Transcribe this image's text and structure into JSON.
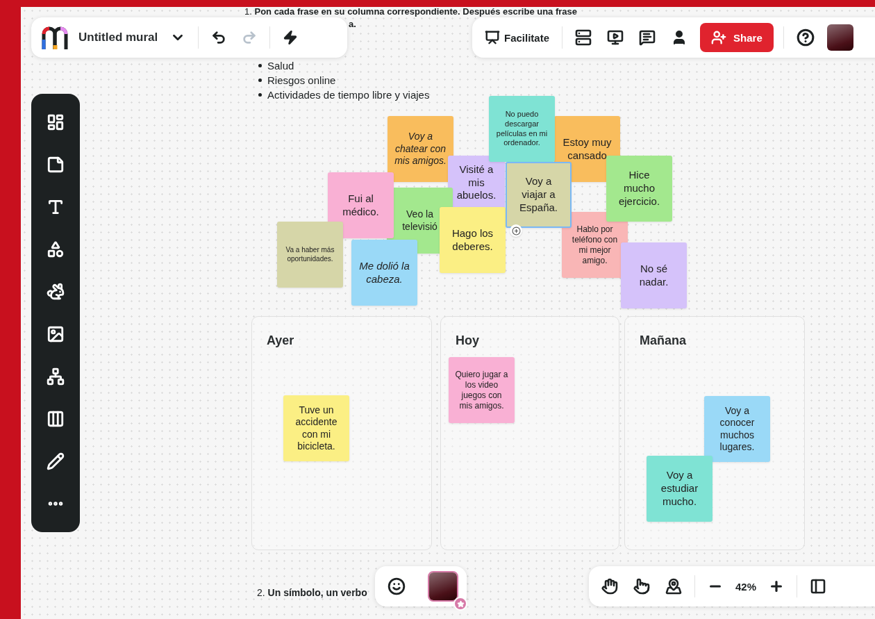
{
  "toolbar": {
    "title": "Untitled mural"
  },
  "topbar": {
    "facilitate": "Facilitate",
    "share": "Share"
  },
  "instructions": {
    "line_1": "1. **Pon cada frase en su columna correspondiente. Después escribe una frase**",
    "line_2_tail": "a."
  },
  "topics": [
    "Salud",
    "Riesgos online",
    "Actividades de tiempo libre y viajes"
  ],
  "stickies": [
    {
      "text": "Voy a chatear con mis amigos.",
      "color": "#f9bd5d",
      "italic": true,
      "selected": false
    },
    {
      "text": "Estoy muy cansado",
      "color": "#f9bd5d",
      "italic": false,
      "selected": false
    },
    {
      "text": "Visité a mis abuelos.",
      "color": "#d5c2fa",
      "italic": false,
      "selected": false
    },
    {
      "text": "No puedo descargar películas en mi ordenador.",
      "color": "#7fe3d4",
      "italic": false,
      "selected": false
    },
    {
      "text": "Me dolió la cabeza.",
      "color": "#9ad9f7",
      "italic": true,
      "selected": false
    },
    {
      "text": "Veo la televisió",
      "color": "#a3e88e",
      "italic": false,
      "selected": false
    },
    {
      "text": "Fui al médico.",
      "color": "#f9b0d4",
      "italic": false,
      "selected": false
    },
    {
      "text": "Hago los deberes.",
      "color": "#fbef84",
      "italic": false,
      "selected": false
    },
    {
      "text": "Hablo por teléfono con mi mejor amigo.",
      "color": "#f9b6b6",
      "italic": false,
      "selected": false
    },
    {
      "text": "Voy a viajar a España.",
      "color": "#d6d6a8",
      "italic": false,
      "selected": true
    },
    {
      "text": "Hice mucho ejercicio.",
      "color": "#a3e88e",
      "italic": false,
      "selected": false
    },
    {
      "text": "No sé nadar.",
      "color": "#d5c2fa",
      "italic": false,
      "selected": false
    },
    {
      "text": "Va a haber más oportunidades.",
      "color": "#d6d6a8",
      "italic": false,
      "selected": false
    }
  ],
  "columns": [
    {
      "title": "Ayer",
      "stickies": [
        {
          "text": "Tuve un accidente con mi bicicleta.",
          "color": "#fbef84"
        }
      ]
    },
    {
      "title": "Hoy",
      "stickies": [
        {
          "text": "Quiero jugar a los video juegos con mis amigos.",
          "color": "#f9b0d4"
        }
      ]
    },
    {
      "title": "Mañana",
      "stickies": [
        {
          "text": "Voy a conocer muchos lugares.",
          "color": "#9ad9f7"
        },
        {
          "text": "Voy a estudiar mucho.",
          "color": "#7fe3d4"
        }
      ]
    }
  ],
  "task_2": "2. **Un símbolo, un verbo**",
  "zoom": {
    "value": "42%"
  }
}
